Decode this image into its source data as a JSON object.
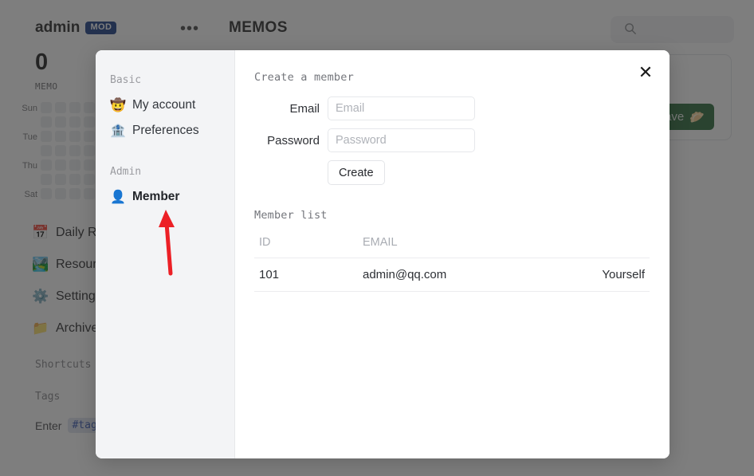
{
  "background": {
    "header": {
      "user_name": "admin",
      "role_badge": "MOD",
      "more_menu": "•••",
      "brand_title": "MEMOS",
      "search_icon": "search-icon"
    },
    "stats": {
      "count": "0",
      "unit": "MEMO"
    },
    "heatmap": {
      "day_labels": [
        "Sun",
        "",
        "Tue",
        "",
        "Thu",
        "",
        "Sat"
      ],
      "columns": 6,
      "rows": 7,
      "empty_color": "#eceef0"
    },
    "nav_items": [
      {
        "icon": "calendar-icon",
        "emoji": "📅",
        "label": "Daily Review"
      },
      {
        "icon": "resources-icon",
        "emoji": "🏞️",
        "label": "Resources"
      },
      {
        "icon": "settings-icon",
        "emoji": "⚙️",
        "label": "Settings"
      },
      {
        "icon": "archive-icon",
        "emoji": "📁",
        "label": "Archived"
      }
    ],
    "shortcuts_label": "Shortcuts",
    "tags_label": "Tags",
    "tag_hint_prefix": "Enter",
    "tag_hint_chip": "#tag",
    "save_button": {
      "label": "Save",
      "emoji": "🥟",
      "color": "#2e6b3e"
    }
  },
  "dialog": {
    "close_label": "✕",
    "sidebar": {
      "sections": [
        {
          "label": "Basic",
          "items": [
            {
              "name": "my-account",
              "emoji": "🤠",
              "label": "My account",
              "active": false
            },
            {
              "name": "preferences",
              "emoji": "🏦",
              "label": "Preferences",
              "active": false
            }
          ]
        },
        {
          "label": "Admin",
          "items": [
            {
              "name": "member",
              "emoji": "👤",
              "label": "Member",
              "active": true
            }
          ]
        }
      ]
    },
    "content": {
      "create_heading": "Create a member",
      "email_label": "Email",
      "email_value": "",
      "email_placeholder": "Email",
      "password_label": "Password",
      "password_value": "",
      "password_placeholder": "Password",
      "create_button": "Create",
      "list_heading": "Member list",
      "table": {
        "columns": [
          "ID",
          "EMAIL",
          ""
        ],
        "rows": [
          {
            "id": "101",
            "email": "admin@qq.com",
            "action": "Yourself"
          }
        ]
      }
    }
  },
  "annotation": {
    "type": "arrow",
    "color": "#ec2026",
    "points_to": "Member"
  }
}
